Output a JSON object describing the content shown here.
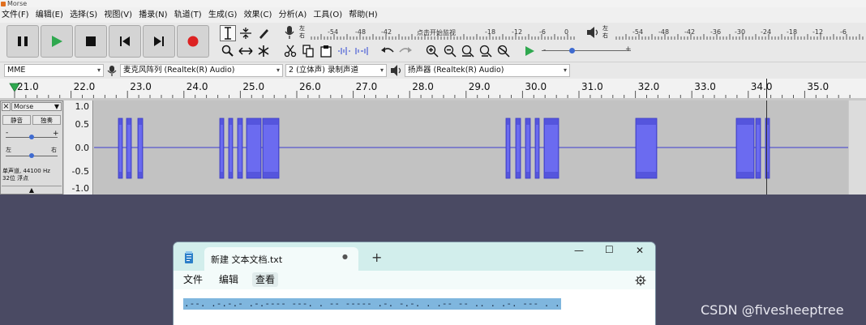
{
  "window": {
    "title": "Morse"
  },
  "menu": [
    "文件(F)",
    "编辑(E)",
    "选择(S)",
    "视图(V)",
    "播录(N)",
    "轨道(T)",
    "生成(G)",
    "效果(C)",
    "分析(A)",
    "工具(O)",
    "帮助(H)"
  ],
  "meters": {
    "record_ticks": [
      "-54",
      "-48",
      "-42",
      "点击开始监视",
      "-18",
      "-12",
      "-6",
      "0"
    ],
    "playback_ticks": [
      "-54",
      "-48",
      "-42",
      "-36",
      "-30",
      "-24",
      "-18",
      "-12",
      "-6"
    ],
    "lr_record": [
      "左",
      "右"
    ],
    "lr_play": [
      "左",
      "右"
    ]
  },
  "devices": {
    "host": "MME",
    "mic": "麦克风阵列 (Realtek(R) Audio)",
    "channels": "2 (立体声) 录制声道",
    "speaker": "扬声器 (Realtek(R) Audio)"
  },
  "ruler": {
    "ticks": [
      "21.0",
      "22.0",
      "23.0",
      "24.0",
      "25.0",
      "26.0",
      "27.0",
      "28.0",
      "29.0",
      "30.0",
      "31.0",
      "32.0",
      "33.0",
      "34.0",
      "35.0"
    ]
  },
  "track": {
    "name": "Morse",
    "mute": "静音",
    "solo": "独奏",
    "info_line1": "单声道, 44100 Hz",
    "info_line2": "32位 浮点",
    "scale": [
      "1.0",
      "0.5",
      "0.0",
      "-0.5",
      "-1.0"
    ],
    "close": "×",
    "collapse": "▲",
    "pan_l": "左",
    "pan_r": "右"
  },
  "notepad": {
    "tab_title": "新建 文本文档.txt",
    "modified_dot": "●",
    "new_tab": "+",
    "menu": [
      "文件",
      "编辑",
      "查看"
    ],
    "content": ".--. .-.-.- .-.---- ---. . -- ----- .-. -.-. . .-- -- .. . .-. --- . .",
    "window_controls": [
      "—",
      "☐",
      "✕"
    ]
  },
  "watermark": "CSDN @fivesheeptree",
  "colors": {
    "waveform": "#5555dd",
    "waveform_edge": "#3a3ac8",
    "accent_green": "#2fa84f",
    "record_red": "#dd2222"
  }
}
